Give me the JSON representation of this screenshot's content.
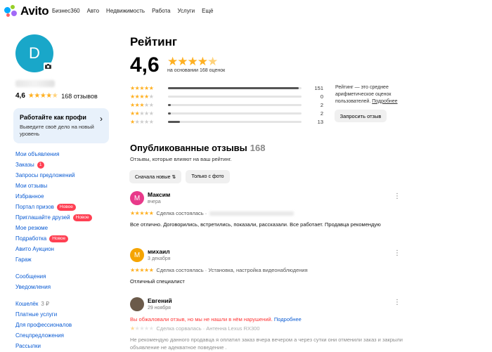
{
  "header": {
    "logo_text": "Avito",
    "nav": [
      "Бизнес360",
      "Авто",
      "Недвижимость",
      "Работа",
      "Услуги",
      "Ещё"
    ]
  },
  "profile": {
    "avatar_letter": "D",
    "rating": "4,6",
    "reviews_count": "168 отзывов"
  },
  "profi_card": {
    "title": "Работайте как профи",
    "subtitle": "Выведите своё дело на новый уровень"
  },
  "menu": {
    "group1": [
      {
        "label": "Мои объявления"
      },
      {
        "label": "Заказы",
        "badge": "1"
      },
      {
        "label": "Запросы предложений"
      },
      {
        "label": "Мои отзывы"
      },
      {
        "label": "Избранное"
      },
      {
        "label": "Портал призов",
        "badge": "Новое"
      },
      {
        "label": "Приглашайте друзей",
        "badge": "Новое"
      },
      {
        "label": "Мое резюме"
      },
      {
        "label": "Подработка",
        "badge": "Новое"
      },
      {
        "label": "Авито Аукцион"
      },
      {
        "label": "Гараж"
      }
    ],
    "group2": [
      {
        "label": "Сообщения"
      },
      {
        "label": "Уведомления"
      }
    ],
    "group3": [
      {
        "label": "Кошелёк",
        "extra": "3 ₽"
      },
      {
        "label": "Платные услуги"
      },
      {
        "label": "Для профессионалов"
      },
      {
        "label": "Спецпредложения"
      },
      {
        "label": "Рассылки"
      }
    ]
  },
  "rating": {
    "title": "Рейтинг",
    "value": "4,6",
    "basis": "на основании 168 оценок",
    "distribution": [
      {
        "stars": 5,
        "count": "151",
        "fraction": 0.98
      },
      {
        "stars": 4,
        "count": "0",
        "fraction": 0
      },
      {
        "stars": 3,
        "count": "2",
        "fraction": 0.02
      },
      {
        "stars": 2,
        "count": "2",
        "fraction": 0.02
      },
      {
        "stars": 1,
        "count": "13",
        "fraction": 0.09
      }
    ],
    "note": "Рейтинг — это среднее арифметическое оценок пользователей.",
    "note_link": "Подробнее",
    "request_button": "Запросить отзыв"
  },
  "reviews_section": {
    "title": "Опубликованные отзывы",
    "count": "168",
    "subtitle": "Отзывы, которые влияют на ваш рейтинг.",
    "filters": [
      "Сначала новые ⇅",
      "Только с фото"
    ]
  },
  "reviews": [
    {
      "avatar_letter": "М",
      "avatar_color": "#e8398a",
      "name": "Максим",
      "date": "вчера",
      "stars": 5,
      "deal": "Сделка состоялась ·",
      "text": "Все отлично. Договорились, встретились, показали, рассказали. Все работает. Продавца рекомендую"
    },
    {
      "avatar_letter": "М",
      "avatar_color": "#f5a400",
      "name": "михаил",
      "date": "3 декабря",
      "stars": 5,
      "deal": "Сделка состоялась · Установка, настройка видеонаблюдения",
      "text": "Отличный специалист"
    },
    {
      "avatar_letter": "",
      "avatar_color": "#6b5a4a",
      "name": "Евгений",
      "date": "29 ноября",
      "stars": 1,
      "warning": "Вы обжаловали отзыв, но мы не нашли в нём нарушений.",
      "warning_link": "Подробнее",
      "deal": "Сделка сорвалась · Антенна Lexus RX300",
      "text": "Не рекомендую данного продавца я оплатил заказ вчера вечером а через сутки они отменили заказ и закрыли объявление не адекватное поведение ."
    }
  ]
}
